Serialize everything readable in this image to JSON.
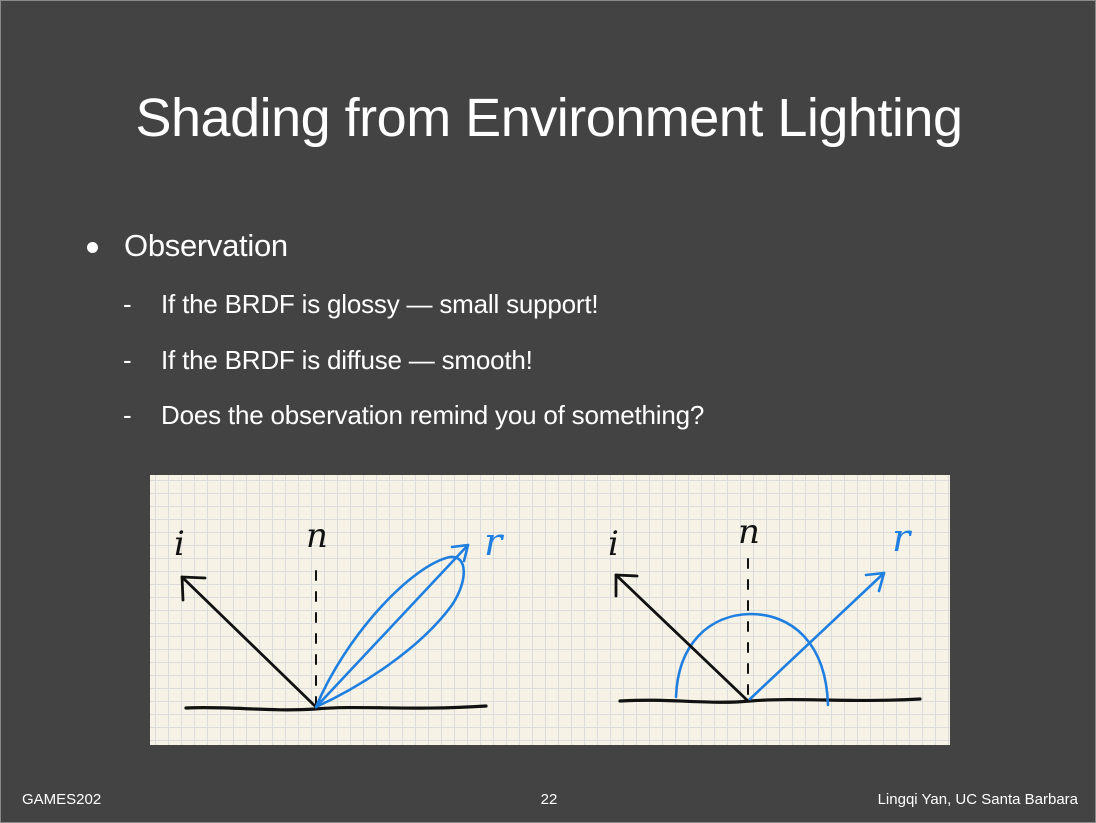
{
  "slide": {
    "title": "Shading from Environment Lighting",
    "bullet": "Observation",
    "sub_bullets": [
      "If the BRDF is glossy — small support!",
      "If the BRDF is diffuse — smooth!",
      "Does the observation remind you of something?"
    ],
    "sub_marker": "-"
  },
  "figure": {
    "glossy": {
      "incident_label": "i",
      "normal_label": "n",
      "reflect_label": "r"
    },
    "diffuse": {
      "incident_label": "i",
      "normal_label": "n",
      "reflect_label": "r"
    },
    "colors": {
      "ink": "#111111",
      "blue": "#1f7fe0",
      "paper": "#f6f3e6",
      "grid": "#dcdcdc"
    }
  },
  "footer": {
    "course": "GAMES202",
    "page_number": "22",
    "author": "Lingqi Yan, UC Santa Barbara"
  }
}
